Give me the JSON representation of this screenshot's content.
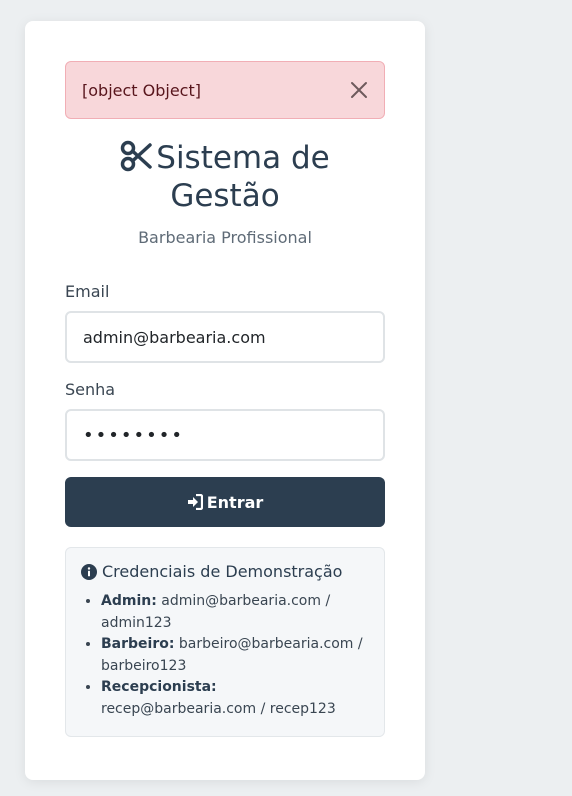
{
  "alert": {
    "message": "[object Object]"
  },
  "header": {
    "title": "Sistema de Gestão",
    "subtitle": "Barbearia Profissional"
  },
  "form": {
    "email_label": "Email",
    "email_value": "admin@barbearia.com",
    "password_label": "Senha",
    "password_value": "••••••••",
    "submit_label": "Entrar"
  },
  "demo": {
    "title": "Credenciais de Demonstração",
    "items": [
      {
        "role": "Admin:",
        "credentials": "admin@barbearia.com / admin123"
      },
      {
        "role": "Barbeiro:",
        "credentials": "barbeiro@barbearia.com / barbeiro123"
      },
      {
        "role": "Recepcionista:",
        "credentials": "recep@barbearia.com / recep123"
      }
    ]
  },
  "colors": {
    "primary": "#2c3e50",
    "alert_bg": "#f8d7da",
    "alert_text": "#58151c",
    "page_bg": "#eceff1"
  },
  "icons": {
    "title": "scissors-icon",
    "alert_close": "close-icon",
    "submit": "sign-in-icon",
    "demo": "info-circle-icon"
  }
}
